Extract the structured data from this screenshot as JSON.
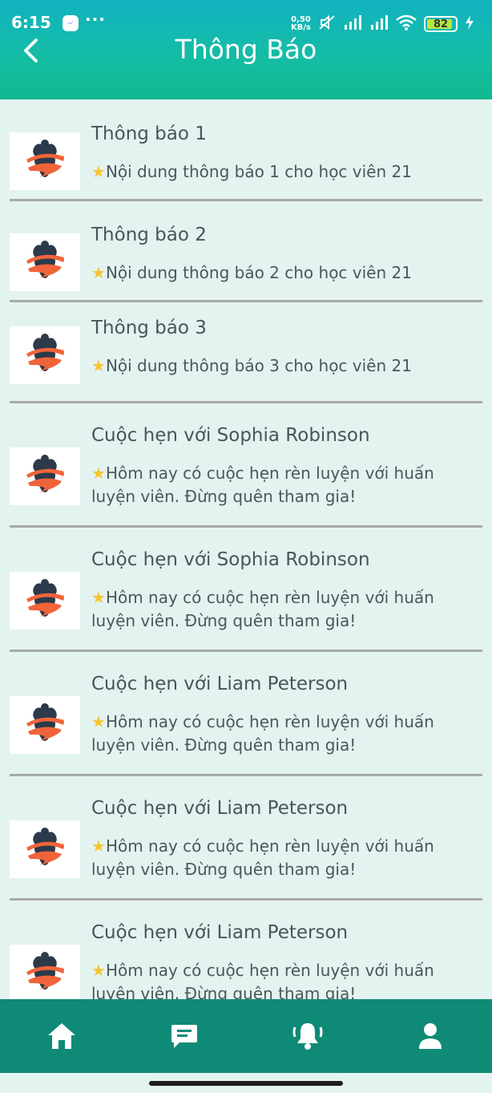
{
  "status_bar": {
    "time": "6:15",
    "dots": "···",
    "speed_value": "0,50",
    "speed_unit": "KB/s",
    "battery": "82"
  },
  "header": {
    "title": "Thông Báo"
  },
  "notifications": [
    {
      "title": "Thông báo 1",
      "body": "Nội dung thông báo 1 cho học viên 21"
    },
    {
      "title": "Thông báo 2",
      "body": "Nội dung thông báo 2 cho học viên 21"
    },
    {
      "title": "Thông báo 3",
      "body": "Nội dung thông báo 3 cho học viên 21"
    },
    {
      "title": "Cuộc hẹn với Sophia Robinson",
      "body": "Hôm nay có cuộc hẹn rèn luyện với huấn luyện viên. Đừng quên tham gia!"
    },
    {
      "title": "Cuộc hẹn với Sophia Robinson",
      "body": "Hôm nay có cuộc hẹn rèn luyện với huấn luyện viên. Đừng quên tham gia!"
    },
    {
      "title": "Cuộc hẹn với Liam Peterson",
      "body": "Hôm nay có cuộc hẹn rèn luyện với huấn luyện viên. Đừng quên tham gia!"
    },
    {
      "title": "Cuộc hẹn với Liam Peterson",
      "body": "Hôm nay có cuộc hẹn rèn luyện với huấn luyện viên. Đừng quên tham gia!"
    },
    {
      "title": "Cuộc hẹn với Liam Peterson",
      "body": "Hôm nay có cuộc hẹn rèn luyện với huấn luyện viên. Đừng quên tham gia!"
    }
  ],
  "icons": {
    "back": "chevron-left-icon",
    "thumb": "gym-logo-icon",
    "star": "star-icon",
    "nav": [
      "home-icon",
      "chat-icon",
      "bell-icon",
      "user-icon"
    ]
  },
  "colors": {
    "header_top": "#12b2c0",
    "header_bottom": "#12b98e",
    "background": "#e3f3f0",
    "bottom_nav": "#0e8a76",
    "separator": "#a7a9ab",
    "logo_dark": "#2c3a4a",
    "logo_accent": "#f0643a"
  }
}
